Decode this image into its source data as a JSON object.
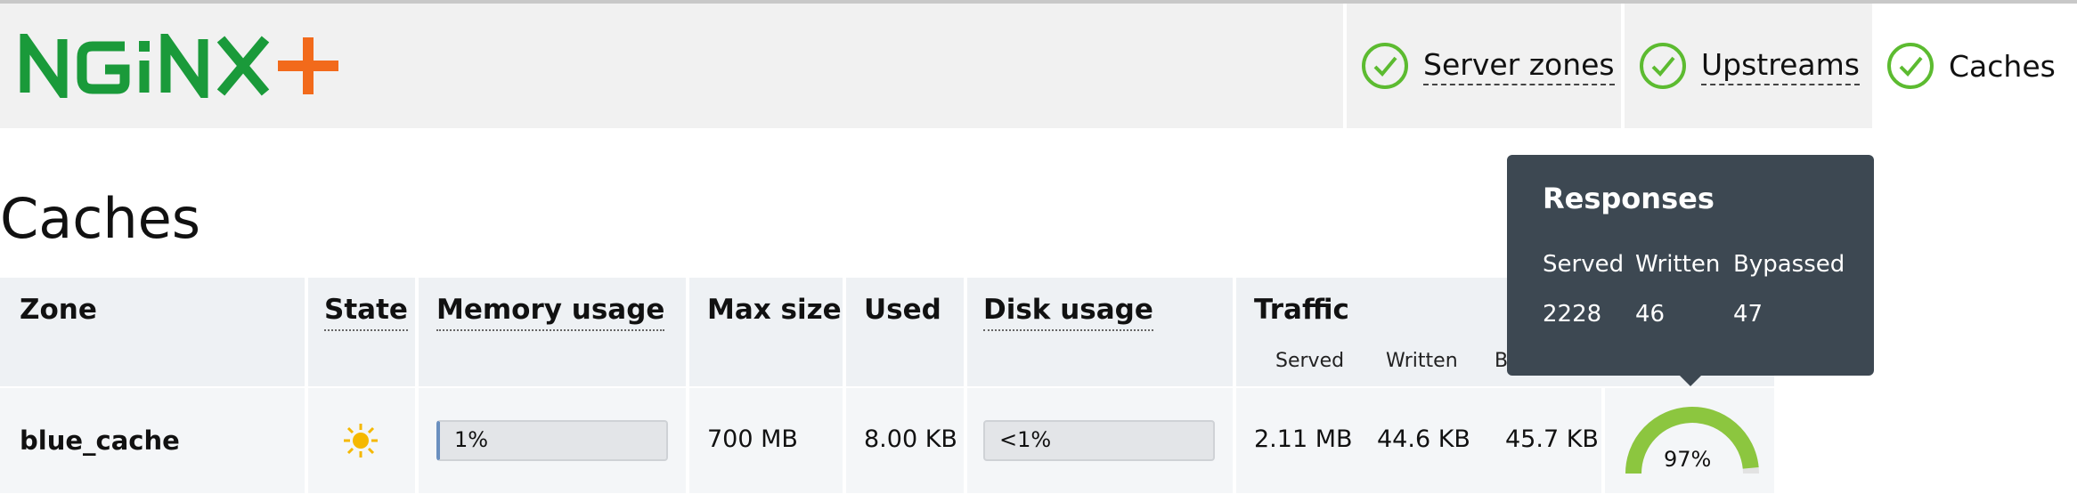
{
  "header": {
    "logo_text": "NGINX+",
    "tabs": [
      {
        "label": "Server zones",
        "status": "ok",
        "active": false
      },
      {
        "label": "Upstreams",
        "status": "ok",
        "active": false
      },
      {
        "label": "Caches",
        "status": "ok",
        "active": true
      }
    ]
  },
  "page": {
    "title": "Caches"
  },
  "table": {
    "headers": {
      "zone": "Zone",
      "state": "State",
      "memory_usage": "Memory usage",
      "max_size": "Max size",
      "used": "Used",
      "disk_usage": "Disk usage",
      "traffic": "Traffic"
    },
    "traffic_sub": {
      "served": "Served",
      "written": "Written",
      "bypassed_partial": "B"
    },
    "rows": [
      {
        "zone": "blue_cache",
        "state_icon": "sun-icon",
        "memory_usage": "1%",
        "max_size": "700 MB",
        "used": "8.00 KB",
        "disk_usage": "<1%",
        "served": "2.11 MB",
        "written": "44.6 KB",
        "bypassed": "45.7 KB",
        "hit_ratio": "97%",
        "hit_ratio_value": 0.97
      }
    ]
  },
  "tooltip": {
    "title": "Responses",
    "headers": [
      "Served",
      "Written",
      "Bypassed"
    ],
    "values": [
      "2228",
      "46",
      "47"
    ]
  },
  "colors": {
    "brand_green": "#1a9a3a",
    "brand_orange": "#f26a1b",
    "check_green": "#5cbb30",
    "gauge_green": "#8cc63f",
    "tooltip_bg": "#3d4852"
  }
}
